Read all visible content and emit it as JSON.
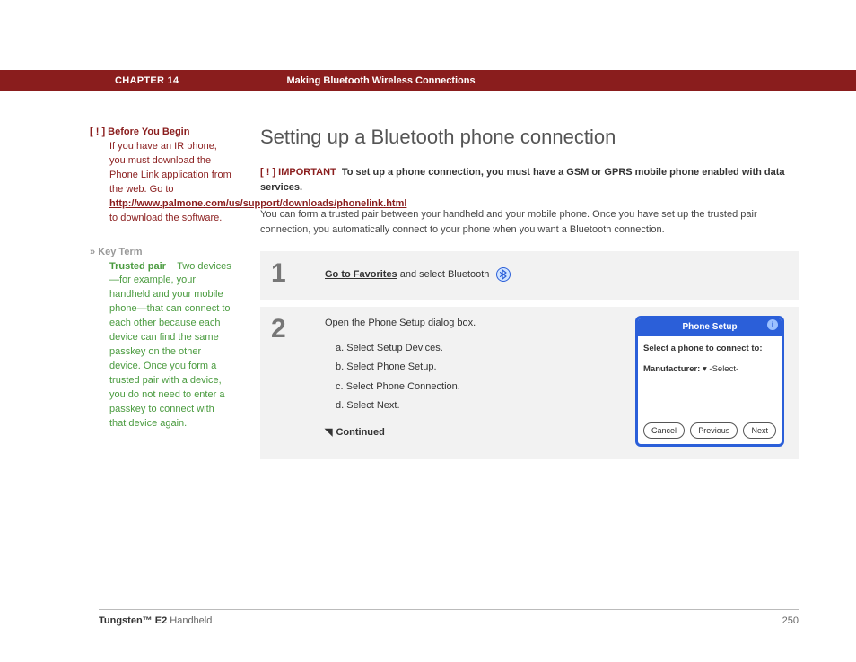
{
  "header": {
    "chapter": "CHAPTER 14",
    "title": "Making Bluetooth Wireless Connections"
  },
  "sidebar": {
    "before": {
      "marker": "[ ! ]",
      "title": "Before You Begin",
      "body1": "If you have an IR phone, you must download the Phone Link application from the web. Go to ",
      "link": "http://www.palmone.com/us/support/downloads/phonelink.html",
      "body2": " to download the software."
    },
    "keyterm": {
      "marker": "»",
      "title": "Key Term",
      "term": "Trusted pair",
      "body": "Two devices—for example, your handheld and your mobile phone—that can connect to each other because each device can find the same passkey on the other device. Once you form a trusted pair with a device, you do not need to enter a passkey to connect with that device again."
    }
  },
  "main": {
    "heading": "Setting up a Bluetooth phone connection",
    "important": {
      "marker": "[ ! ]",
      "label": "IMPORTANT",
      "text": "To set up a phone connection, you must have a GSM or GPRS mobile phone enabled with data services."
    },
    "intro": "You can form a trusted pair between your handheld and your mobile phone. Once you have set up the trusted pair connection, you automatically connect to your phone when you want a Bluetooth connection.",
    "steps": {
      "s1": {
        "num": "1",
        "link": "Go to Favorites",
        "rest": " and select Bluetooth"
      },
      "s2": {
        "num": "2",
        "lead": "Open the Phone Setup dialog box.",
        "a": "a.  Select Setup Devices.",
        "b": "b.  Select Phone Setup.",
        "c": "c.  Select Phone Connection.",
        "d": "d.  Select Next.",
        "continued": "Continued"
      }
    },
    "dialog": {
      "title": "Phone Setup",
      "prompt": "Select a phone to connect to:",
      "mfr_label": "Manufacturer:",
      "mfr_value": "-Select-",
      "btn_cancel": "Cancel",
      "btn_prev": "Previous",
      "btn_next": "Next"
    }
  },
  "footer": {
    "product_bold": "Tungsten™ E2",
    "product_rest": " Handheld",
    "page": "250"
  }
}
